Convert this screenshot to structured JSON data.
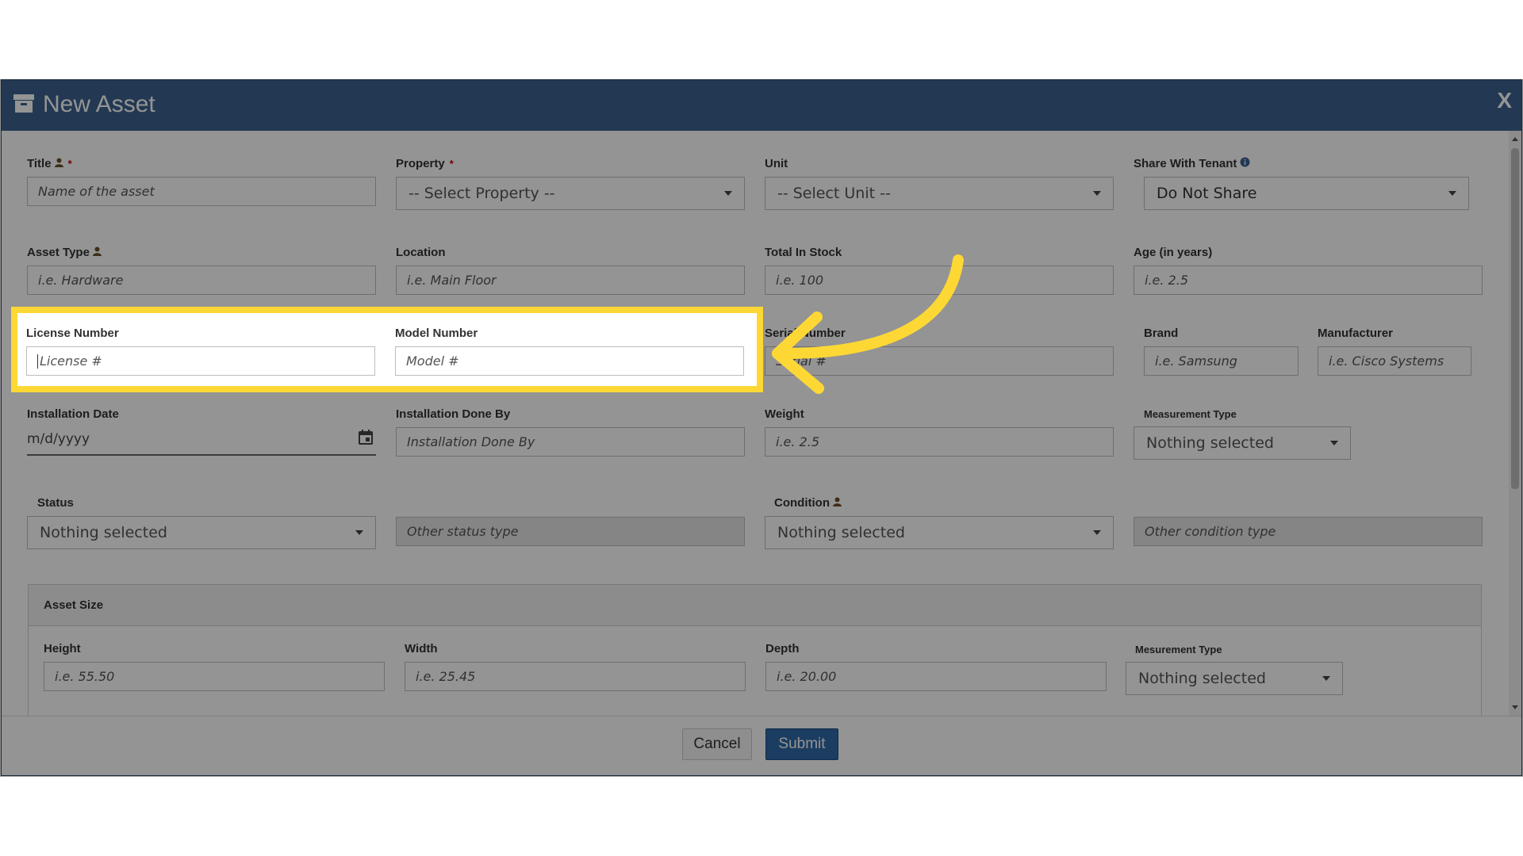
{
  "modal": {
    "title": "New Asset",
    "close_label": "X"
  },
  "fields": {
    "title": {
      "label": "Title",
      "required": "*",
      "placeholder": "Name of the asset"
    },
    "property": {
      "label": "Property",
      "required": "*",
      "value": "-- Select Property --"
    },
    "unit": {
      "label": "Unit",
      "value": "-- Select Unit --"
    },
    "share": {
      "label": "Share With Tenant",
      "value": "Do Not Share"
    },
    "asset_type": {
      "label": "Asset Type",
      "placeholder": "i.e. Hardware"
    },
    "location": {
      "label": "Location",
      "placeholder": "i.e. Main Floor"
    },
    "total_stock": {
      "label": "Total In Stock",
      "placeholder": "i.e. 100"
    },
    "age": {
      "label": "Age (in years)",
      "placeholder": "i.e. 2.5"
    },
    "license": {
      "label": "License Number",
      "placeholder": "License #"
    },
    "model": {
      "label": "Model Number",
      "placeholder": "Model #"
    },
    "serial": {
      "label": "Serial Number",
      "placeholder": "Serial #"
    },
    "brand": {
      "label": "Brand",
      "placeholder": "i.e. Samsung"
    },
    "manufacturer": {
      "label": "Manufacturer",
      "placeholder": "i.e. Cisco Systems"
    },
    "installation_date": {
      "label": "Installation Date",
      "placeholder": "m/d/yyyy"
    },
    "installation_by": {
      "label": "Installation Done By",
      "placeholder": "Installation Done By"
    },
    "weight": {
      "label": "Weight",
      "placeholder": "i.e. 2.5"
    },
    "measurement_type": {
      "label": "Measurement Type",
      "value": "Nothing selected"
    },
    "status": {
      "label": "Status",
      "value": "Nothing selected"
    },
    "other_status": {
      "placeholder": "Other status type"
    },
    "condition": {
      "label": "Condition",
      "value": "Nothing selected"
    },
    "other_condition": {
      "placeholder": "Other condition type"
    }
  },
  "asset_size": {
    "heading": "Asset Size",
    "height": {
      "label": "Height",
      "placeholder": "i.e. 55.50"
    },
    "width": {
      "label": "Width",
      "placeholder": "i.e. 25.45"
    },
    "depth": {
      "label": "Depth",
      "placeholder": "i.e. 20.00"
    },
    "measurement_type": {
      "label": "Mesurement Type",
      "value": "Nothing selected"
    }
  },
  "footer": {
    "cancel_label": "Cancel",
    "submit_label": "Submit"
  },
  "colors": {
    "header_bg": "#3d628f",
    "submit_bg": "#2f6aa8",
    "highlight": "#fdd835"
  },
  "icons": {
    "header": "archive-box-icon",
    "user": "user-icon",
    "info": "info-circle-icon",
    "calendar": "calendar-icon",
    "arrow": "curved-arrow-icon"
  }
}
